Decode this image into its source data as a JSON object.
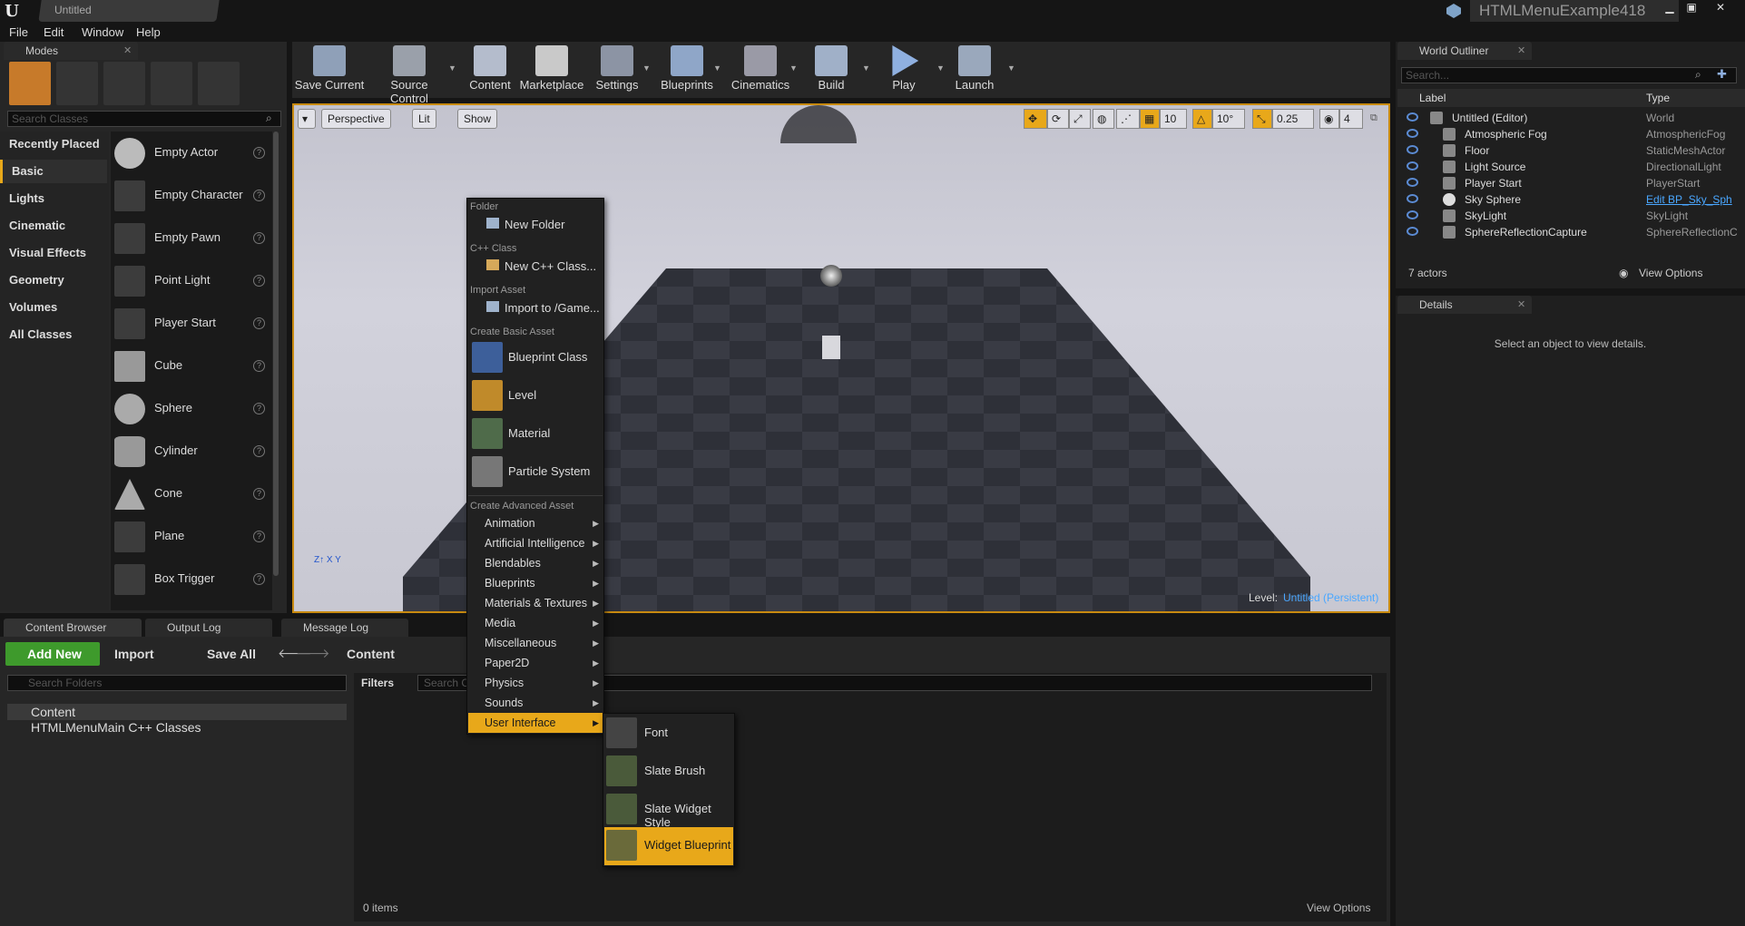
{
  "titlebar": {
    "doc_tab": "Untitled",
    "project": "HTMLMenuExample418",
    "min": "▁",
    "max": "▣",
    "close": "✕"
  },
  "menubar": [
    "File",
    "Edit",
    "Window",
    "Help"
  ],
  "modes": {
    "tab": "Modes",
    "search_placeholder": "Search Classes",
    "categories": [
      "Recently Placed",
      "Basic",
      "Lights",
      "Cinematic",
      "Visual Effects",
      "Geometry",
      "Volumes",
      "All Classes"
    ],
    "classes": [
      "Empty Actor",
      "Empty Character",
      "Empty Pawn",
      "Point Light",
      "Player Start",
      "Cube",
      "Sphere",
      "Cylinder",
      "Cone",
      "Plane",
      "Box Trigger"
    ]
  },
  "toolbar": [
    "Save Current",
    "Source Control",
    "Content",
    "Marketplace",
    "Settings",
    "Blueprints",
    "Cinematics",
    "Build",
    "Play",
    "Launch"
  ],
  "viewport": {
    "perspective": "Perspective",
    "lit": "Lit",
    "show": "Show",
    "grid": "10",
    "rot": "10°",
    "scale": "0.25",
    "cam": "4",
    "level_label": "Level:",
    "level_name": "Untitled (Persistent)"
  },
  "outliner": {
    "tab": "World Outliner",
    "search_placeholder": "Search...",
    "col_label": "Label",
    "col_type": "Type",
    "rows": [
      {
        "label": "Untitled (Editor)",
        "type": "World"
      },
      {
        "label": "Atmospheric Fog",
        "type": "AtmosphericFog"
      },
      {
        "label": "Floor",
        "type": "StaticMeshActor"
      },
      {
        "label": "Light Source",
        "type": "DirectionalLight"
      },
      {
        "label": "Player Start",
        "type": "PlayerStart"
      },
      {
        "label": "Sky Sphere",
        "type": "Edit BP_Sky_Sph"
      },
      {
        "label": "SkyLight",
        "type": "SkyLight"
      },
      {
        "label": "SphereReflectionCapture",
        "type": "SphereReflectionC"
      }
    ],
    "count": "7 actors",
    "view_options": "View Options"
  },
  "details": {
    "tab": "Details",
    "empty": "Select an object to view details."
  },
  "content_browser": {
    "tabs": [
      "Content Browser",
      "Output Log",
      "Message Log"
    ],
    "add_new": "Add New",
    "import": "Import",
    "save_all": "Save All",
    "path": "Content",
    "folder_search": "Search Folders",
    "folders": [
      "Content",
      "HTMLMenuMain C++ Classes"
    ],
    "filters": "Filters",
    "asset_search": "Search C",
    "items": "0 items",
    "view_options": "View Options"
  },
  "context_menu": {
    "folder_head": "Folder",
    "new_folder": "New Folder",
    "cpp_head": "C++ Class",
    "new_cpp": "New C++ Class...",
    "import_head": "Import Asset",
    "import_to": "Import to /Game...",
    "basic_head": "Create Basic Asset",
    "basic": [
      "Blueprint Class",
      "Level",
      "Material",
      "Particle System"
    ],
    "adv_head": "Create Advanced Asset",
    "advanced": [
      "Animation",
      "Artificial Intelligence",
      "Blendables",
      "Blueprints",
      "Materials & Textures",
      "Media",
      "Miscellaneous",
      "Paper2D",
      "Physics",
      "Sounds",
      "User Interface"
    ],
    "submenu": [
      "Font",
      "Slate Brush",
      "Slate Widget Style",
      "Widget Blueprint"
    ]
  },
  "colors": {
    "highlight": "#e8a81a",
    "accent_blue": "#4aa7ff",
    "add_green": "#3e9a2c"
  }
}
